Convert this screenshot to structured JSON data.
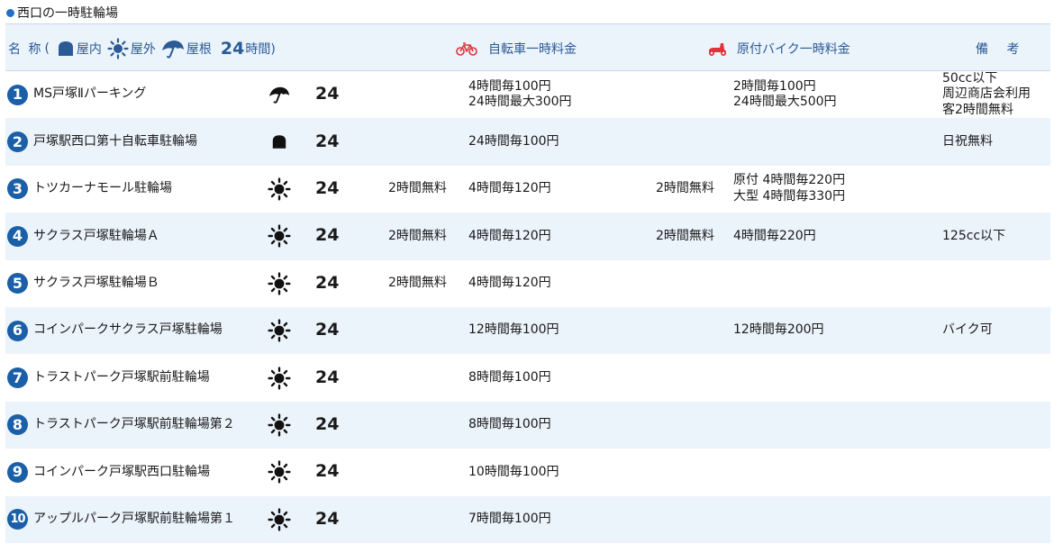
{
  "title": "西口の一時駐輪場",
  "header": {
    "name_label": "名 称",
    "paren_open": "(",
    "indoor_label": "屋内",
    "outdoor_label": "屋外",
    "roof_label": "屋根",
    "h24_label": "24",
    "hours_label": "時間)",
    "bike_label": "自転車一時料金",
    "moto_label": "原付バイク一時料金",
    "note_label": "備 考"
  },
  "colors": {
    "accent": "#1f6fc5",
    "header_bg": "#ebf3fb",
    "header_text": "#2a5b96",
    "badge": "#1b5fa8",
    "moto_red": "#e0343a"
  },
  "icons": {
    "indoor": "indoor-icon",
    "outdoor": "sun-icon",
    "roof": "umbrella-icon",
    "bike": "bicycle-icon",
    "moto": "scooter-icon"
  },
  "rows": [
    {
      "num": "1",
      "name": "MS戸塚Ⅱパーキング",
      "type": "roof",
      "hours": "24",
      "bike_free": "",
      "bike_fee": [
        "4時間毎100円",
        "24時間最大300円"
      ],
      "moto_free": "",
      "moto_fee": [
        "2時間毎100円",
        "24時間最大500円"
      ],
      "note": [
        "50cc以下",
        "周辺商店会利用",
        "客2時間無料"
      ]
    },
    {
      "num": "2",
      "name": "戸塚駅西口第十自転車駐輪場",
      "type": "indoor",
      "hours": "24",
      "bike_free": "",
      "bike_fee": [
        "24時間毎100円"
      ],
      "moto_free": "",
      "moto_fee": [],
      "note": [
        "日祝無料"
      ]
    },
    {
      "num": "3",
      "name": "トツカーナモール駐輪場",
      "type": "outdoor",
      "hours": "24",
      "bike_free": "2時間無料",
      "bike_fee": [
        "4時間毎120円"
      ],
      "moto_free": "2時間無料",
      "moto_fee": [
        "原付 4時間毎220円",
        "大型 4時間毎330円"
      ],
      "note": []
    },
    {
      "num": "4",
      "name": "サクラス戸塚駐輪場Ａ",
      "type": "outdoor",
      "hours": "24",
      "bike_free": "2時間無料",
      "bike_fee": [
        "4時間毎120円"
      ],
      "moto_free": "2時間無料",
      "moto_fee": [
        "4時間毎220円"
      ],
      "note": [
        "125cc以下"
      ]
    },
    {
      "num": "5",
      "name": "サクラス戸塚駐輪場Ｂ",
      "type": "outdoor",
      "hours": "24",
      "bike_free": "2時間無料",
      "bike_fee": [
        "4時間毎120円"
      ],
      "moto_free": "",
      "moto_fee": [],
      "note": []
    },
    {
      "num": "6",
      "name": "コインパークサクラス戸塚駐輪場",
      "type": "outdoor",
      "hours": "24",
      "bike_free": "",
      "bike_fee": [
        "12時間毎100円"
      ],
      "moto_free": "",
      "moto_fee": [
        "12時間毎200円"
      ],
      "note": [
        "バイク可"
      ]
    },
    {
      "num": "7",
      "name": "トラストパーク戸塚駅前駐輪場",
      "type": "outdoor",
      "hours": "24",
      "bike_free": "",
      "bike_fee": [
        "8時間毎100円"
      ],
      "moto_free": "",
      "moto_fee": [],
      "note": []
    },
    {
      "num": "8",
      "name": "トラストパーク戸塚駅前駐輪場第２",
      "type": "outdoor",
      "hours": "24",
      "bike_free": "",
      "bike_fee": [
        "8時間毎100円"
      ],
      "moto_free": "",
      "moto_fee": [],
      "note": []
    },
    {
      "num": "9",
      "name": "コインパーク戸塚駅西口駐輪場",
      "type": "outdoor",
      "hours": "24",
      "bike_free": "",
      "bike_fee": [
        "10時間毎100円"
      ],
      "moto_free": "",
      "moto_fee": [],
      "note": []
    },
    {
      "num": "10",
      "name": "アップルパーク戸塚駅前駐輪場第１",
      "type": "outdoor",
      "hours": "24",
      "bike_free": "",
      "bike_fee": [
        "7時間毎100円"
      ],
      "moto_free": "",
      "moto_fee": [],
      "note": []
    }
  ]
}
